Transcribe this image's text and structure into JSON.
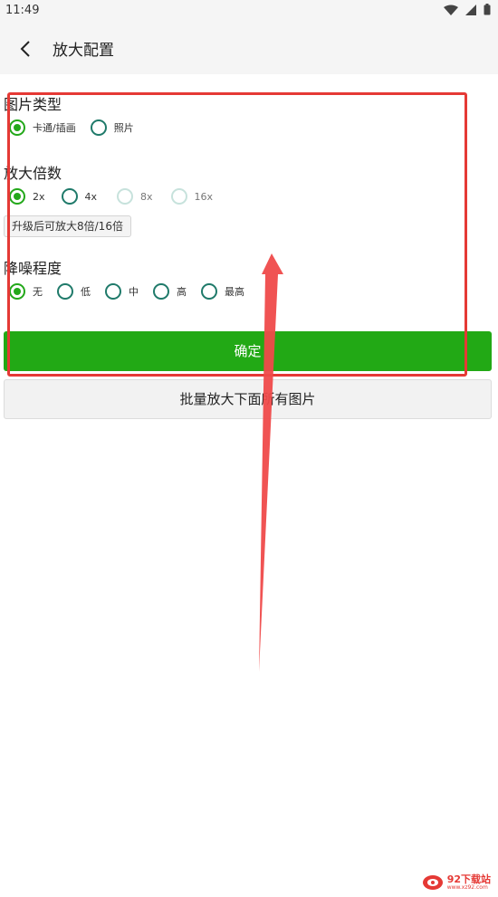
{
  "status_bar": {
    "time": "11:49"
  },
  "app_bar": {
    "title": "放大配置"
  },
  "image_type": {
    "title": "图片类型",
    "options": [
      {
        "label": "卡通/插画",
        "checked": true
      },
      {
        "label": "照片",
        "checked": false
      }
    ]
  },
  "scale": {
    "title": "放大倍数",
    "options": [
      {
        "label": "2x",
        "checked": true
      },
      {
        "label": "4x",
        "checked": false
      },
      {
        "label": "8x",
        "checked": false,
        "disabled": true
      },
      {
        "label": "16x",
        "checked": false,
        "disabled": true
      }
    ],
    "upgrade_label": "升级后可放大8倍/16倍"
  },
  "denoise": {
    "title": "降噪程度",
    "options": [
      {
        "label": "无",
        "checked": true
      },
      {
        "label": "低",
        "checked": false
      },
      {
        "label": "中",
        "checked": false
      },
      {
        "label": "高",
        "checked": false
      },
      {
        "label": "最高",
        "checked": false
      }
    ]
  },
  "buttons": {
    "confirm": "确定",
    "batch": "批量放大下面所有图片"
  },
  "watermark": {
    "main": "92下载站",
    "sub": "www.xz92.com"
  },
  "colors": {
    "accent": "#23a81a",
    "radio_border": "#1f7a6a",
    "annotation": "#e53935"
  },
  "icons": [
    "wifi-icon",
    "signal-icon",
    "battery-icon",
    "back-arrow-icon"
  ]
}
